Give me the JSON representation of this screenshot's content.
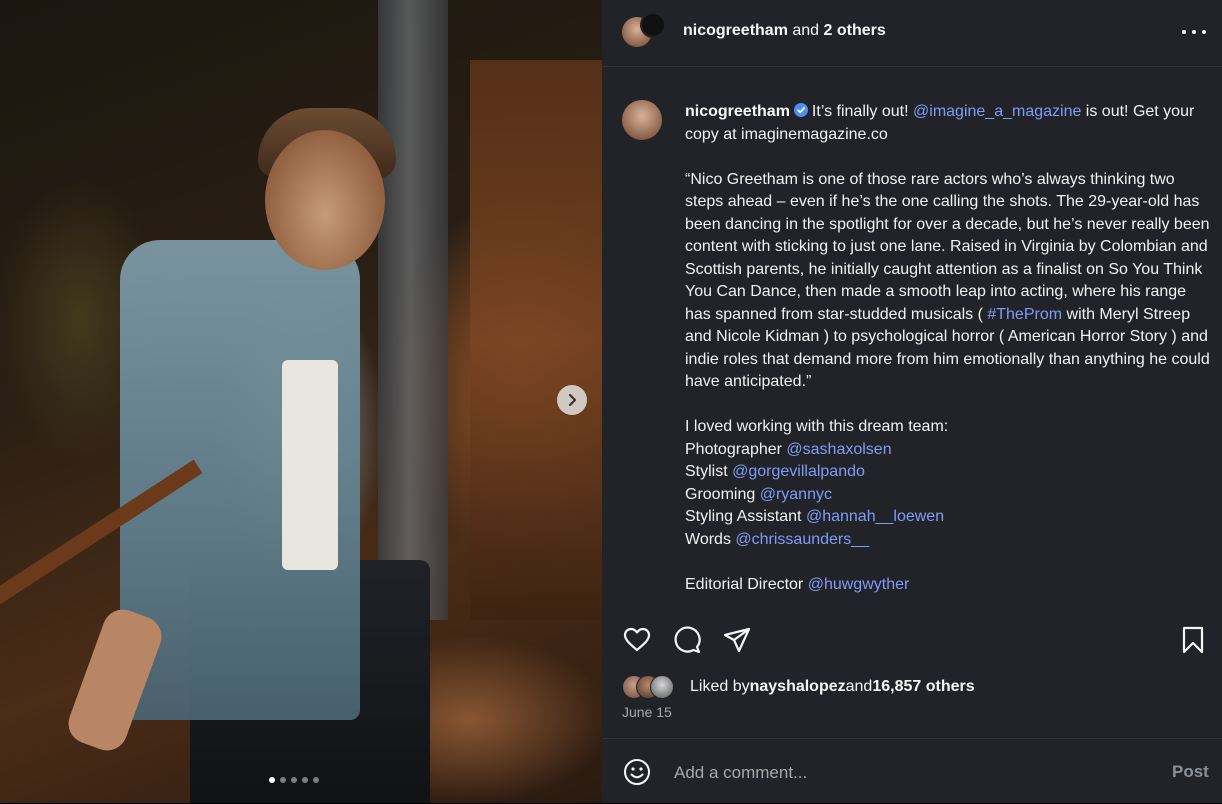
{
  "header": {
    "username": "nicogreetham",
    "suffix_and": " and ",
    "suffix_others": "2 others"
  },
  "media": {
    "carousel_total": 5,
    "carousel_active": 1
  },
  "caption": {
    "username": "nicogreetham",
    "intro_1": "It’s finally out! ",
    "mention_magazine": "@imagine_a_magazine",
    "intro_2": " is out! Get your copy at imaginemagazine.co",
    "quote_1": "“Nico Greetham is one of those rare actors who’s always thinking two steps ahead – even if he’s the one calling the shots. The 29-year-old has been dancing in the spotlight for over a decade, but he’s never really been content with sticking to just one lane. Raised in Virginia by Colombian and Scottish parents, he initially caught attention as a finalist on So You Think You Can Dance, then made a smooth leap into acting, where his range has spanned from star-studded musicals ( ",
    "hashtag_prom": "#TheProm",
    "quote_2": " with Meryl Streep and Nicole Kidman ) to psychological horror ( American Horror Story ) and indie roles that demand more from him emotionally than anything he could have anticipated.”",
    "team_heading": "I loved working with this dream team:",
    "credits": [
      {
        "role": "Photographer ",
        "handle": "@sashaxolsen"
      },
      {
        "role": "Stylist ",
        "handle": "@gorgevillalpando"
      },
      {
        "role": "Grooming ",
        "handle": "@ryannyc"
      },
      {
        "role": "Styling Assistant ",
        "handle": "@hannah__loewen"
      },
      {
        "role": "Words ",
        "handle": "@chrissaunders__"
      },
      {
        "role": "Editorial Director ",
        "handle": "@huwgwyther"
      }
    ]
  },
  "likes": {
    "prefix": "Liked by ",
    "user": "nayshalopez",
    "mid": " and ",
    "others": "16,857 others"
  },
  "date": "June 15",
  "comment": {
    "placeholder": "Add a comment...",
    "post_label": "Post"
  },
  "colors": {
    "panel_bg": "#212328",
    "link": "#7f9cf5",
    "verified": "#4a90f0"
  },
  "icons": [
    "chevron-right-icon",
    "heart-icon",
    "comment-icon",
    "share-icon",
    "bookmark-icon",
    "more-icon",
    "verified-badge-icon",
    "emoji-icon"
  ]
}
